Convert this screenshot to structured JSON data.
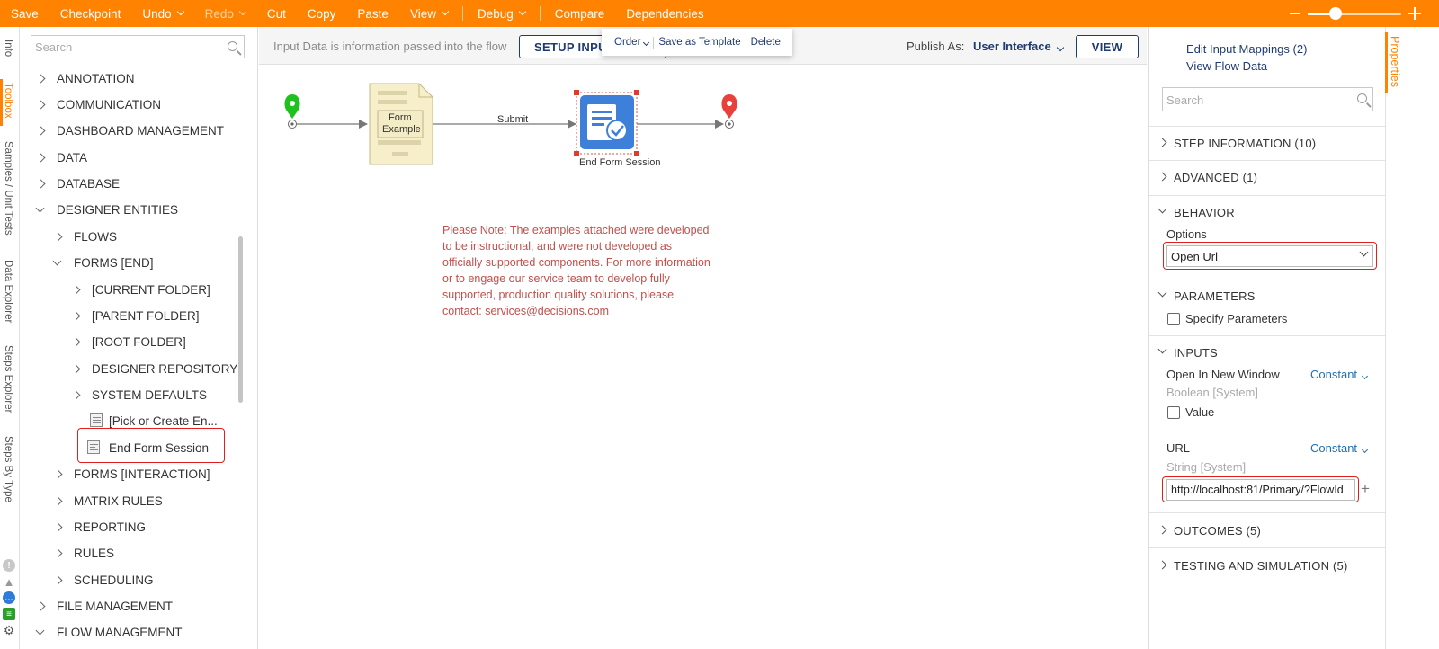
{
  "toolbar": {
    "items": [
      "Save",
      "Checkpoint",
      "Undo",
      "Redo",
      "Cut",
      "Copy",
      "Paste",
      "View",
      "Debug",
      "Compare",
      "Dependencies"
    ],
    "zoom_level_fraction": 0.3
  },
  "left_tabs": [
    "Info",
    "Toolbox",
    "Samples / Unit Tests",
    "Data Explorer",
    "Steps Explorer",
    "Steps By Type"
  ],
  "toolbox": {
    "search_placeholder": "Search",
    "items": [
      {
        "label": "ANNOTATION"
      },
      {
        "label": "COMMUNICATION"
      },
      {
        "label": "DASHBOARD MANAGEMENT"
      },
      {
        "label": "DATA"
      },
      {
        "label": "DATABASE"
      },
      {
        "label": "DESIGNER ENTITIES"
      },
      {
        "label": "FLOWS"
      },
      {
        "label": "FORMS [END]"
      },
      {
        "label": "[CURRENT FOLDER]"
      },
      {
        "label": "[PARENT FOLDER]"
      },
      {
        "label": "[ROOT FOLDER]"
      },
      {
        "label": "DESIGNER REPOSITORY"
      },
      {
        "label": "SYSTEM DEFAULTS"
      },
      {
        "label": "[Pick or Create En..."
      },
      {
        "label": "End Form Session"
      },
      {
        "label": "FORMS [INTERACTION]"
      },
      {
        "label": "MATRIX RULES"
      },
      {
        "label": "REPORTING"
      },
      {
        "label": "RULES"
      },
      {
        "label": "SCHEDULING"
      },
      {
        "label": "FILE MANAGEMENT"
      },
      {
        "label": "FLOW MANAGEMENT"
      }
    ]
  },
  "canvas_header": {
    "info_text": "Input Data is information passed into the flow",
    "setup_inputs_label": "SETUP INPUTS",
    "publish_as_label": "Publish As:",
    "publish_as_value": "User Interface",
    "view_label": "VIEW"
  },
  "popup": {
    "order_label": "Order",
    "save_template_label": "Save as Template",
    "delete_label": "Delete"
  },
  "flow": {
    "form_step_label_1": "Form",
    "form_step_label_2": "Example",
    "submit_label": "Submit",
    "end_step_label": "End Form Session",
    "start_color": "#1fc11f",
    "end_color": "#e8413c",
    "step_color": "#3d7fd9"
  },
  "note": "Please Note: The examples attached were developed to be instructional, and were not developed as officially supported components. For more information or to engage our service team to develop fully supported, production quality solutions, please contact: services@decisions.com",
  "properties": {
    "tab_label": "Properties",
    "edit_input_mappings": "Edit Input Mappings (2)",
    "view_flow_data": "View Flow Data",
    "search_placeholder": "Search",
    "sections": {
      "step_information": "STEP INFORMATION (10)",
      "advanced": "ADVANCED (1)",
      "behavior": "BEHAVIOR",
      "parameters": "PARAMETERS",
      "inputs": "INPUTS",
      "outcomes": "OUTCOMES (5)",
      "testing": "TESTING AND SIMULATION (5)"
    },
    "options_label": "Options",
    "options_value": "Open Url",
    "specify_parameters": "Specify Parameters",
    "open_new_window_label": "Open In New Window",
    "open_new_window_mode": "Constant",
    "open_new_window_type": "Boolean [System]",
    "value_label": "Value",
    "url_label": "URL",
    "url_mode": "Constant",
    "url_type": "String [System]",
    "url_value": "http://localhost:81/Primary/?FlowId"
  },
  "colors": {
    "toolbar_bg": "#ff8200",
    "accent": "#ff8200",
    "navy": "#1f3b73",
    "highlight": "#e0201e"
  }
}
